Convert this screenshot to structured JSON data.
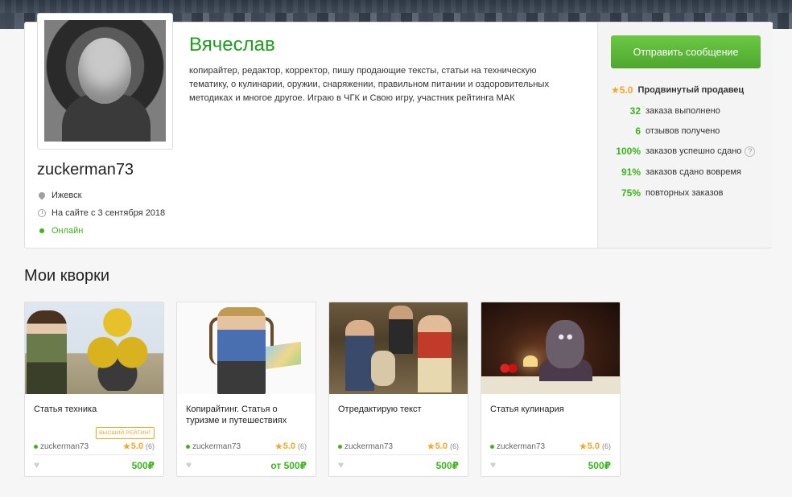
{
  "profile": {
    "name": "Вячеслав",
    "username": "zuckerman73",
    "bio": "копирайтер, редактор, корректор, пишу продающие тексты, статьи на техническую тематику, о кулинарии, оружии, снаряжении, правильном питании и оздоровительных методиках и многое другое. Играю в ЧГК и Свою игру, участник рейтинга МАК",
    "city": "Ижевск",
    "since": "На сайте с 3 сентября 2018",
    "status": "Онлайн"
  },
  "sidebar": {
    "send_label": "Отправить сообщение",
    "stats": [
      {
        "value": "5.0",
        "label": "Продвинутый продавец"
      },
      {
        "value": "32",
        "label": "заказа выполнено"
      },
      {
        "value": "6",
        "label": "отзывов получено"
      },
      {
        "value": "100%",
        "label": "заказов успешно сдано"
      },
      {
        "value": "91%",
        "label": "заказов сдано вовремя"
      },
      {
        "value": "75%",
        "label": "повторных заказов"
      }
    ]
  },
  "section_title": "Мои кворки",
  "kworks": [
    {
      "title": "Статья техника",
      "badge": "ВЫСШИЙ РЕЙТИНГ",
      "author": "zuckerman73",
      "rating": "5.0",
      "reviews": "(6)",
      "price": "500₽"
    },
    {
      "title": "Копирайтинг. Статья о туризме и путешествиях",
      "badge": "",
      "author": "zuckerman73",
      "rating": "5.0",
      "reviews": "(6)",
      "price": "от 500₽"
    },
    {
      "title": "Отредактирую текст",
      "badge": "",
      "author": "zuckerman73",
      "rating": "5.0",
      "reviews": "(6)",
      "price": "500₽"
    },
    {
      "title": "Статья кулинария",
      "badge": "",
      "author": "zuckerman73",
      "rating": "5.0",
      "reviews": "(6)",
      "price": "500₽"
    }
  ],
  "colors": {
    "accent_green": "#3bb51a",
    "name_green": "#1ca01c",
    "star_orange": "#f5a623"
  },
  "icons": {
    "location": "map-pin-icon",
    "since": "clock-icon",
    "online": "status-dot-icon",
    "star": "star-icon",
    "help": "question-circle-icon",
    "favorite": "heart-icon"
  }
}
